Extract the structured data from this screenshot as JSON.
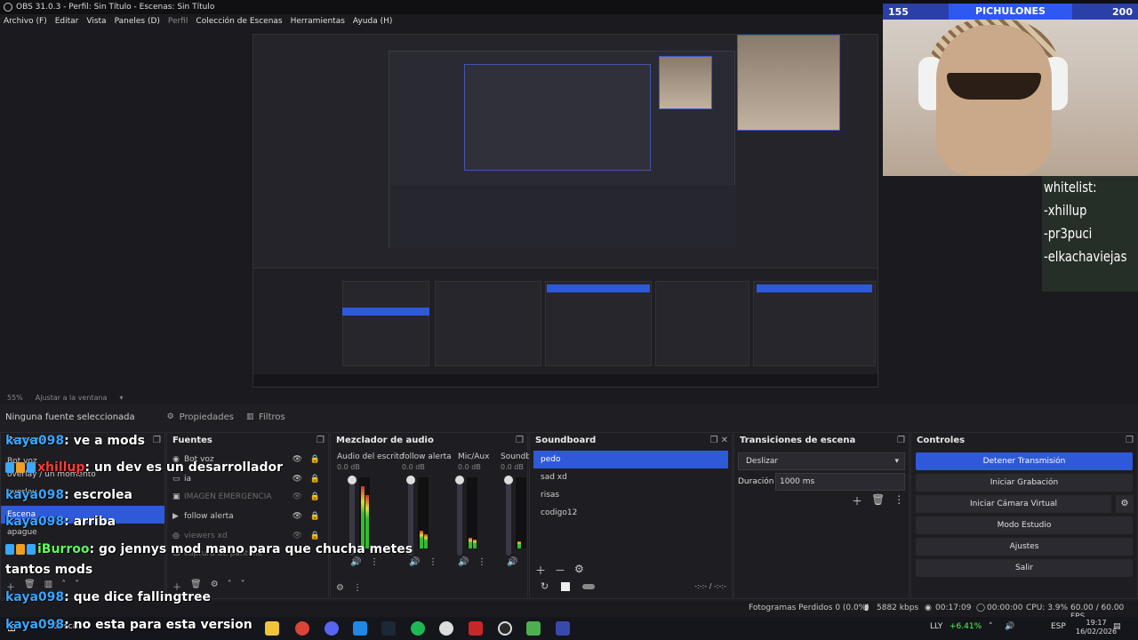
{
  "window": {
    "title": "OBS 31.0.3 - Perfil: Sin Título - Escenas: Sin Título"
  },
  "menu": {
    "items": [
      "Archivo (F)",
      "Editar",
      "Vista",
      "Paneles (D)",
      "Perfil",
      "Colección de Escenas",
      "Herramientas",
      "Ayuda (H)"
    ]
  },
  "preview": {
    "zoom": "55%",
    "fit_label": "Ajustar a la ventana"
  },
  "overlay": {
    "score_left": "155",
    "score_team": "PICHULONES",
    "score_right": "200",
    "whitelist": [
      "whitelist:",
      "-xhillup",
      "-pr3puci",
      "-elkachaviejas"
    ]
  },
  "source_toolbar": {
    "status": "Ninguna fuente seleccionada",
    "properties": "Propiedades",
    "filters": "Filtros"
  },
  "docks": {
    "scenes": {
      "title": "Escenas",
      "items": [
        "Bot voz",
        "overlay / un momento",
        "overlay",
        "Escena",
        "apague"
      ],
      "selected": "Escena"
    },
    "sources": {
      "title": "Fuentes",
      "items": [
        {
          "name": "Bot voz"
        },
        {
          "name": "ia"
        },
        {
          "name": "IMAGEN EMERGENCIA"
        },
        {
          "name": "follow alerta"
        },
        {
          "name": "viewers xd"
        },
        {
          "name": "captura de pantalla"
        }
      ]
    },
    "mixer": {
      "title": "Mezclador de audio",
      "channels": [
        {
          "name": "Audio del escrito",
          "db": "0.0 dB"
        },
        {
          "name": "follow alerta",
          "db": "0.0 dB"
        },
        {
          "name": "Mic/Aux",
          "db": "0.0 dB"
        },
        {
          "name": "Soundb",
          "db": "0.0 dB"
        }
      ]
    },
    "soundboard": {
      "title": "Soundboard",
      "items": [
        "pedo",
        "sad xd",
        "risas",
        "codigo12"
      ],
      "selected": "pedo",
      "timer": "-:-:- / -:-:-"
    },
    "transitions": {
      "title": "Transiciones de escena",
      "type": "Deslizar",
      "duration_label": "Duración",
      "duration": "1000 ms"
    },
    "controls": {
      "title": "Controles",
      "buttons": [
        "Detener Transmisión",
        "Iniciar Grabación",
        "Iniciar Cámara Virtual",
        "Modo Estudio",
        "Ajustes",
        "Salir"
      ]
    }
  },
  "chat": [
    {
      "user": "kaya098",
      "text": "ve a mods"
    },
    {
      "user": "xhillup",
      "text": "un dev es un desarrollador"
    },
    {
      "user": "kaya098",
      "text": "escrolea"
    },
    {
      "user": "kaya098",
      "text": "arriba"
    },
    {
      "user": "iBurroo",
      "text": "go jennys mod mano para que chucha metes"
    },
    {
      "user": "",
      "text": "tantos mods"
    },
    {
      "user": "kaya098",
      "text": "que dice fallingtree"
    },
    {
      "user": "kaya098",
      "text": "no esta para esta version"
    }
  ],
  "status": {
    "dropped": "Fotogramas Perdidos 0 (0.0%)",
    "bitrate": "5882 kbps",
    "live_time": "00:17:09",
    "rec_time": "00:00:00",
    "cpu": "CPU: 3.9%",
    "fps": "60.00 / 60.00 FPS"
  },
  "taskbar": {
    "search": "Buscar",
    "stock": "LLY",
    "stock_change": "+6.41%",
    "lang": "ESP",
    "time": "19:17",
    "date": "16/02/2026"
  },
  "colors": {
    "accent": "#2e59d9",
    "bg": "#1f1f23",
    "user_blue": "#3aa7ff",
    "user_red": "#ff3b3b",
    "user_green": "#5cff5c"
  }
}
